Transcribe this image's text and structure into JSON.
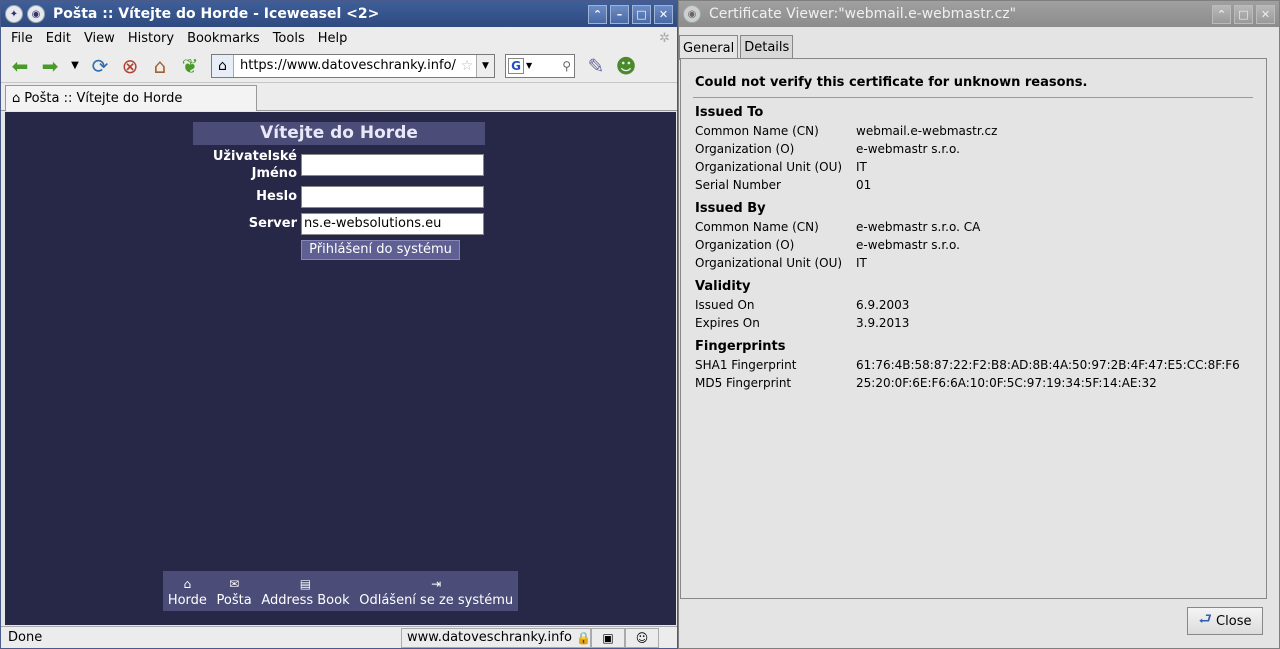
{
  "browser": {
    "title": "Pošta :: Vítejte do Horde - Iceweasel <2>",
    "menu": [
      "File",
      "Edit",
      "View",
      "History",
      "Bookmarks",
      "Tools",
      "Help"
    ],
    "url": "https://www.datoveschranky.info/",
    "tab_title": "Pošta :: Vítejte do Horde",
    "status_left": "Done",
    "status_url": "www.datoveschranky.info"
  },
  "login": {
    "title": "Vítejte do Horde",
    "username_label_line1": "Uživatelské",
    "username_label_line2": "Jméno",
    "username_value": "",
    "password_label": "Heslo",
    "password_value": "",
    "server_label": "Server",
    "server_value": "ns.e-websolutions.eu",
    "login_button": "Přihlášení do systému"
  },
  "footer_nav": [
    {
      "label": "Horde",
      "icon": "home-icon"
    },
    {
      "label": "Pošta",
      "icon": "mail-icon"
    },
    {
      "label": "Address Book",
      "icon": "address-book-icon"
    },
    {
      "label": "Odlášení se ze systému",
      "icon": "logout-icon"
    }
  ],
  "cert": {
    "title": "Certificate Viewer:\"webmail.e-webmastr.cz\"",
    "tabs": [
      "General",
      "Details"
    ],
    "message": "Could not verify this certificate for unknown reasons.",
    "issued_to": {
      "heading": "Issued To",
      "rows": [
        {
          "k": "Common Name (CN)",
          "v": "webmail.e-webmastr.cz"
        },
        {
          "k": "Organization (O)",
          "v": "e-webmastr s.r.o."
        },
        {
          "k": "Organizational Unit (OU)",
          "v": "IT"
        },
        {
          "k": "Serial Number",
          "v": "01"
        }
      ]
    },
    "issued_by": {
      "heading": "Issued By",
      "rows": [
        {
          "k": "Common Name (CN)",
          "v": "e-webmastr s.r.o. CA"
        },
        {
          "k": "Organization (O)",
          "v": "e-webmastr s.r.o."
        },
        {
          "k": "Organizational Unit (OU)",
          "v": "IT"
        }
      ]
    },
    "validity": {
      "heading": "Validity",
      "rows": [
        {
          "k": "Issued On",
          "v": "6.9.2003"
        },
        {
          "k": "Expires On",
          "v": "3.9.2013"
        }
      ]
    },
    "fingerprints": {
      "heading": "Fingerprints",
      "rows": [
        {
          "k": "SHA1 Fingerprint",
          "v": "61:76:4B:58:87:22:F2:B8:AD:8B:4A:50:97:2B:4F:47:E5:CC:8F:F6"
        },
        {
          "k": "MD5 Fingerprint",
          "v": "25:20:0F:6E:F6:6A:10:0F:5C:97:19:34:5F:14:AE:32"
        }
      ]
    },
    "close_button": "Close"
  }
}
